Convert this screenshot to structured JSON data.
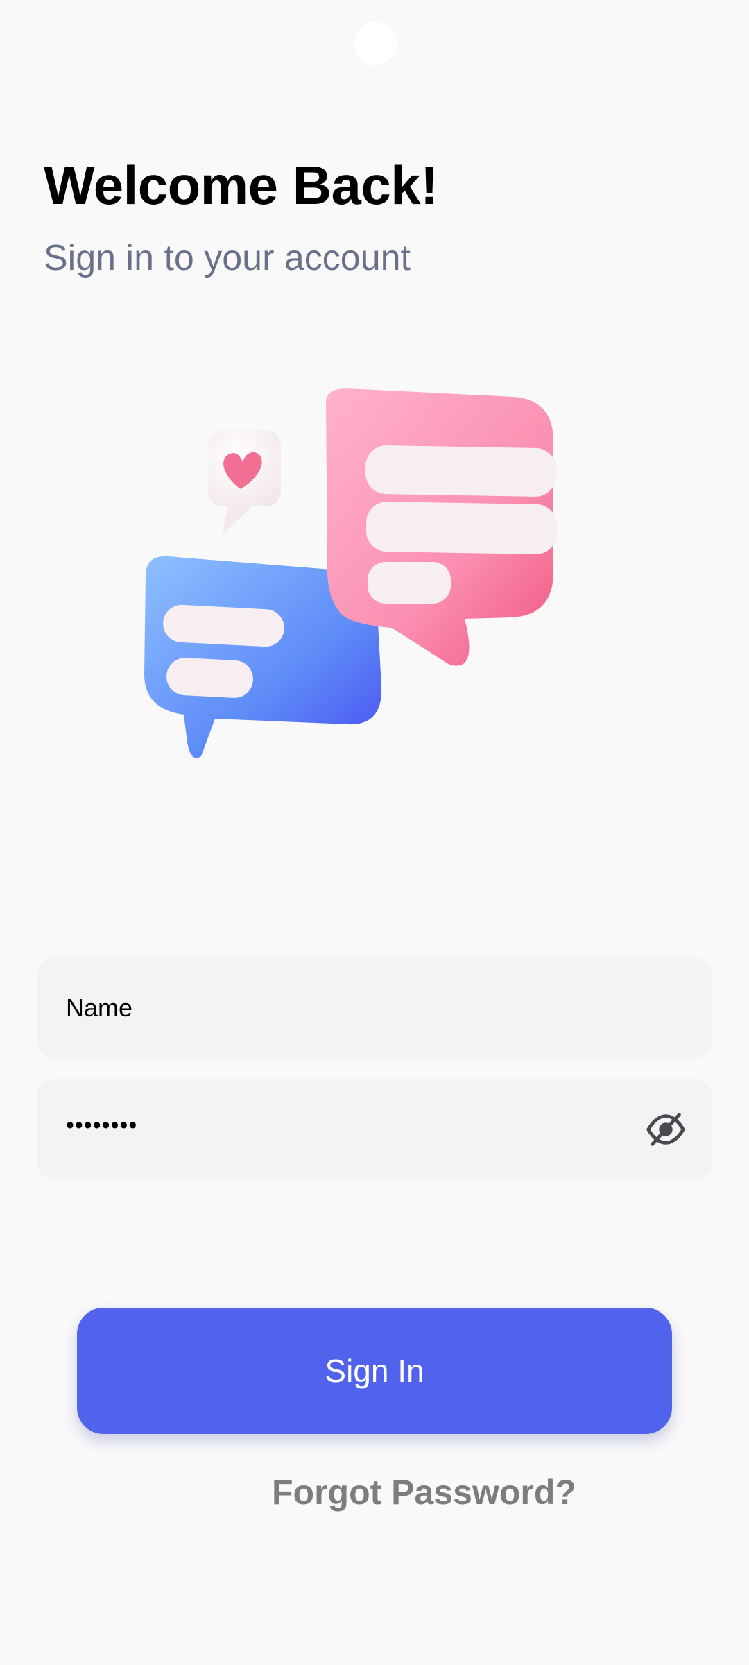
{
  "header": {
    "title": "Welcome Back!",
    "subtitle": "Sign in to your account"
  },
  "illustration": {
    "icon": "chat-bubbles-illustration",
    "colors": {
      "pink": "#f97fa4",
      "blue": "#5b83f5",
      "heart": "#f06f93"
    }
  },
  "form": {
    "name_value": "Name",
    "password_value": "••••••••",
    "password_toggle_icon": "eye-slash-icon"
  },
  "actions": {
    "sign_in_label": "Sign In",
    "forgot_label": "Forgot Password?"
  },
  "colors": {
    "accent": "#5162ec",
    "background": "#f9f9fa",
    "field_bg": "#f3f3f5",
    "subtitle": "#6b7089"
  }
}
